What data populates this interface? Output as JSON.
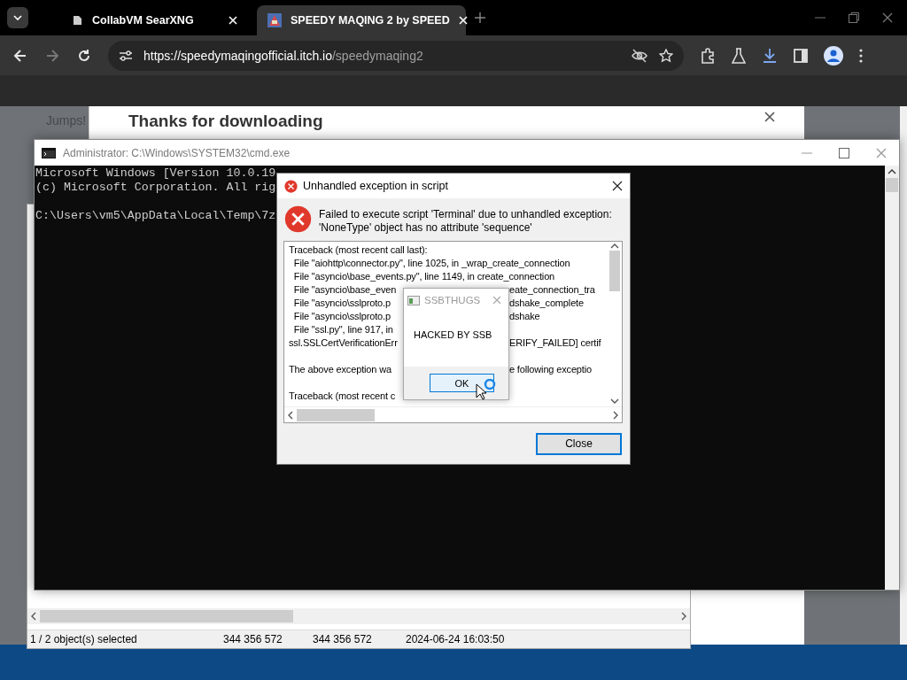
{
  "browser": {
    "tabs": [
      {
        "title": "CollabVM SearXNG",
        "selected": false
      },
      {
        "title": "SPEEDY MAQING 2 by SPEED",
        "selected": true
      }
    ],
    "nav_buttons": [
      {
        "kind": "back",
        "disabled": false
      },
      {
        "kind": "forward",
        "disabled": true
      },
      {
        "kind": "reload",
        "disabled": false
      }
    ],
    "address": {
      "host": "https://speedymaqingofficial.itch.io",
      "path": "/speedymaqing2"
    }
  },
  "page": {
    "side_text": "Jumps!",
    "modal_title": "Thanks for downloading"
  },
  "explorer": {
    "status": [
      "1 / 2 object(s) selected",
      "344 356 572",
      "344 356 572",
      "2024-06-24 16:03:50"
    ]
  },
  "console": {
    "title": "Administrator: C:\\Windows\\SYSTEM32\\cmd.exe",
    "paragraphs": [
      [
        "Microsoft Windows [Version 10.0.19",
        "(c) Microsoft Corporation. All rig"
      ],
      [
        "C:\\Users\\vm5\\AppData\\Local\\Temp\\7z"
      ]
    ]
  },
  "error_dialog": {
    "title": "Unhandled exception in script",
    "message": [
      "Failed to execute script 'Terminal' due to unhandled exception:",
      "'NoneType' object has no attribute 'sequence'"
    ],
    "traceback": [
      [
        {
          "left": "Traceback (most recent call last):"
        },
        {
          "left": "  File \"aiohttp\\connector.py\", line 1025, in _wrap_create_connection"
        },
        {
          "left": "  File \"asyncio\\base_events.py\", line 1149, in create_connection"
        },
        {
          "left": "  File \"asyncio\\base_even",
          "right": "eate_connection_tra"
        },
        {
          "left": "  File \"asyncio\\sslproto.p",
          "right": "dshake_complete"
        },
        {
          "left": "  File \"asyncio\\sslproto.p",
          "right": "dshake"
        },
        {
          "left": "  File \"ssl.py\", line 917, in"
        },
        {
          "left": "ssl.SSLCertVerificationErr",
          "right": "ERIFY_FAILED] certif"
        }
      ],
      [
        {
          "left": "The above exception wa",
          "right": "e following exceptio"
        }
      ],
      [
        {
          "left": "Traceback (most recent c"
        }
      ]
    ],
    "button": "Close"
  },
  "popup": {
    "title": "SSBTHUGS",
    "message": "HACKED BY SSB",
    "button": "OK"
  }
}
